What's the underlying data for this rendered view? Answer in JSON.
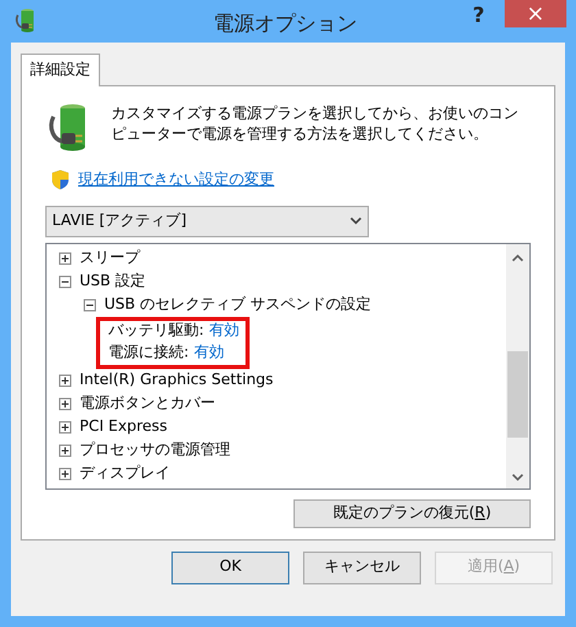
{
  "window": {
    "title": "電源オプション",
    "help": "?",
    "close": "×"
  },
  "tabs": [
    {
      "label": "詳細設定",
      "selected": true
    }
  ],
  "description": "カスタマイズする電源プランを選択してから、お使いのコンピューターで電源を管理する方法を選択してください。",
  "link": "現在利用できない設定の変更",
  "plan_select": {
    "value": "LAVIE [アクティブ]"
  },
  "tree": [
    {
      "kind": "group",
      "label": "スリープ",
      "expanded": false
    },
    {
      "kind": "group",
      "label": "USB 設定",
      "expanded": true,
      "children": [
        {
          "kind": "group",
          "label": "USB のセレクティブ サスペンドの設定",
          "expanded": true,
          "highlighted": true,
          "children": [
            {
              "kind": "setting",
              "label": "バッテリ駆動:",
              "value": "有効"
            },
            {
              "kind": "setting",
              "label": "電源に接続:",
              "value": "有効"
            }
          ]
        }
      ]
    },
    {
      "kind": "group",
      "label": "Intel(R) Graphics Settings",
      "expanded": false
    },
    {
      "kind": "group",
      "label": "電源ボタンとカバー",
      "expanded": false
    },
    {
      "kind": "group",
      "label": "PCI Express",
      "expanded": false
    },
    {
      "kind": "group",
      "label": "プロセッサの電源管理",
      "expanded": false
    },
    {
      "kind": "group",
      "label": "ディスプレイ",
      "expanded": false
    }
  ],
  "restore_button": {
    "text": "既定のプランの復元(",
    "access_key": "R",
    "text_end": ")"
  },
  "buttons": [
    {
      "text": "OK",
      "default": true,
      "disabled": false
    },
    {
      "text": "キャンセル",
      "default": false,
      "disabled": false
    },
    {
      "text": "適用(",
      "access_key": "A",
      "text_end": ")",
      "default": false,
      "disabled": true
    }
  ]
}
